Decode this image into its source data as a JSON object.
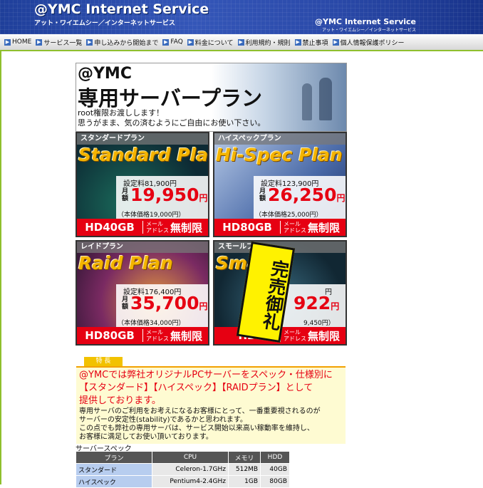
{
  "header": {
    "title": "@YMC Internet Service",
    "subtitle": "アット・ワイエムシー／インターネットサービス",
    "right_title": "@YMC Internet Service",
    "right_subtitle": "アット・ワイエムシー／インターネットサービス"
  },
  "nav": {
    "items": [
      {
        "label": "HOME"
      },
      {
        "label": "サービス一覧"
      },
      {
        "label": "申し込みから開始まで"
      },
      {
        "label": "FAQ"
      },
      {
        "label": "料金について"
      },
      {
        "label": "利用規約・規則"
      },
      {
        "label": "禁止事項"
      },
      {
        "label": "個人情報保護ポリシー"
      }
    ]
  },
  "banner": {
    "brand": "@YMC",
    "heading": "専用サーバープラン",
    "line1": "root権限お渡しします！",
    "line2": "思うがまま、気の済むようにご自由にお使い下さい。"
  },
  "plans": [
    {
      "tag": "スタンダードプラン",
      "name": "Standard Plan",
      "setup": "設定料81,900円",
      "monthly_label": "月額",
      "price": "19,950",
      "yen": "円",
      "base": "（本体価格19,000円）",
      "hdd": "HD40GB",
      "mail": "メール アドレス",
      "unlimited": "無制限"
    },
    {
      "tag": "ハイスペックプラン",
      "name": "Hi-Spec Plan",
      "setup": "設定料123,900円",
      "monthly_label": "月額",
      "price": "26,250",
      "yen": "円",
      "base": "（本体価格25,000円）",
      "hdd": "HD80GB",
      "mail": "メール アドレス",
      "unlimited": "無制限"
    },
    {
      "tag": "レイドプラン",
      "name": "Raid Plan",
      "setup": "設定料176,400円",
      "monthly_label": "月額",
      "price": "35,700",
      "yen": "円",
      "base": "（本体価格34,000円）",
      "hdd": "HD80GB",
      "mail": "メール アドレス",
      "unlimited": "無制限"
    },
    {
      "tag": "スモールプラ",
      "name": "Small",
      "setup": "円",
      "monthly_label": "",
      "price": "922",
      "yen": "円",
      "base": "9,450円）",
      "hdd": "HD",
      "mail": "メール アドレス",
      "unlimited": "無制限"
    }
  ],
  "soldout": "完売御礼",
  "feature": {
    "tab": "特 長",
    "headline1": "@YMCでは弊社オリジナルPCサーバーをスペック・仕様別に",
    "headline2": "【スタンダード】【ハイスペック】【RAIDプラン】として",
    "headline3": "提供しております。",
    "body1": "専用サーバのご利用をお考えになるお客様にとって、一番重要視されるのが",
    "body2": "サーバーの安定性(stability)であるかと思われます。",
    "body3": "この点でも弊社の専用サーバは、サービス開始以来高い稼動率を維持し、",
    "body4": "お客様に満足してお使い頂いております。"
  },
  "spec": {
    "title": "サーバースペック",
    "headers": [
      "プラン",
      "CPU",
      "メモリ",
      "HDD"
    ],
    "rows": [
      [
        "スタンダード",
        "Celeron-1.7GHz",
        "512MB",
        "40GB"
      ],
      [
        "ハイスペック",
        "Pentium4-2.4GHz",
        "1GB",
        "80GB"
      ]
    ]
  }
}
